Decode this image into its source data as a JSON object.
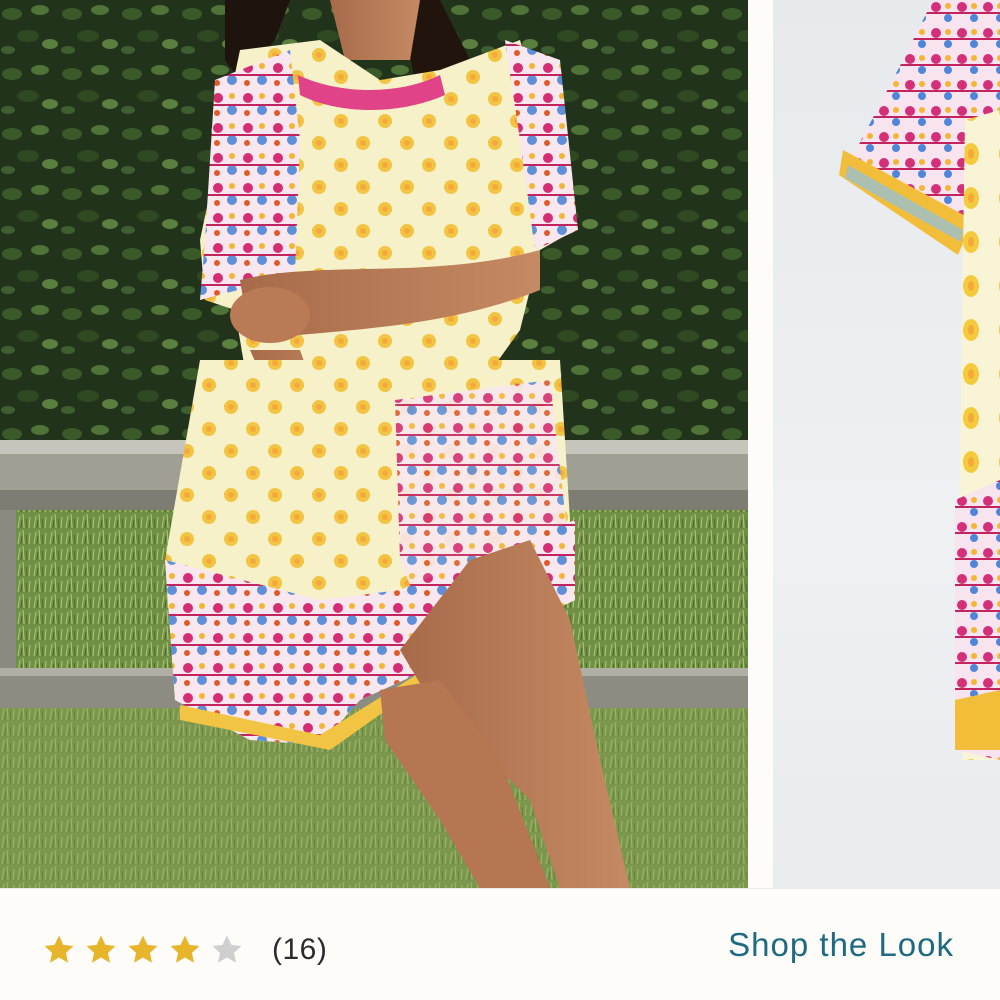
{
  "product": {
    "rating": {
      "value": 4,
      "max": 5,
      "review_count_text": "(16)",
      "star_color_filled": "#e6b52b",
      "star_color_empty": "#cfcfcf"
    },
    "shop_the_look_label": "Shop the Look"
  },
  "gallery": {
    "images": [
      {
        "name": "model-wearing-dress-photo"
      },
      {
        "name": "dress-product-photo"
      }
    ]
  },
  "colors": {
    "link": "#1e6a82",
    "background": "#fdfcf8"
  }
}
